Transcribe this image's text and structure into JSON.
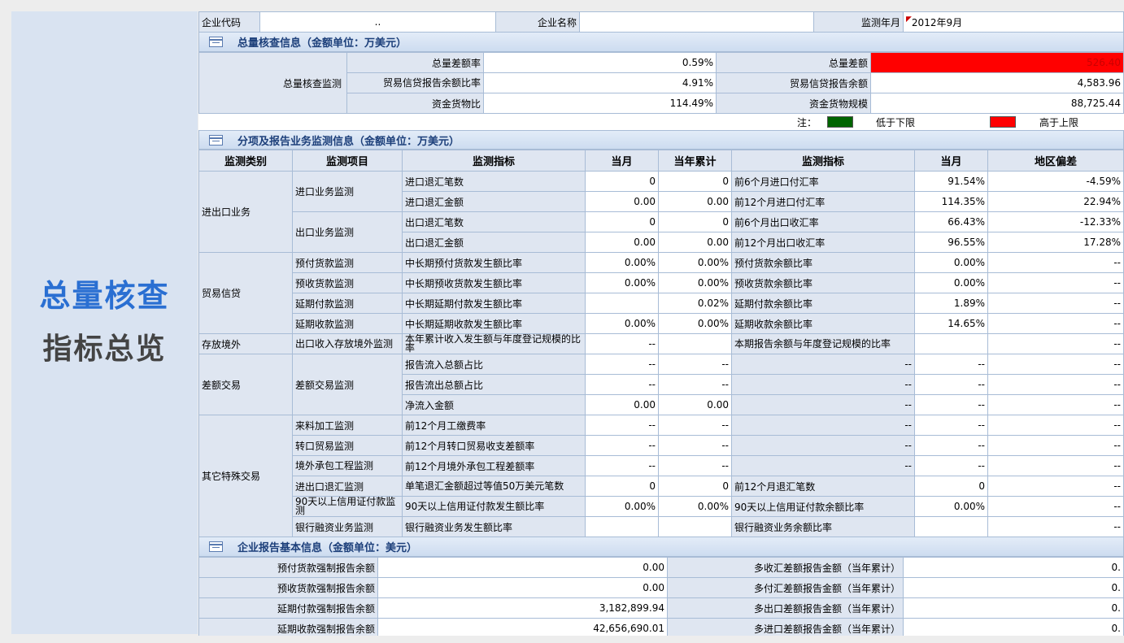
{
  "left_panel": {
    "line1": "总量核查",
    "line2": "指标总览"
  },
  "top": {
    "code_label": "企业代码",
    "code_value": "..",
    "name_label": "企业名称",
    "name_value": "",
    "month_label": "监测年月",
    "month_value": "2012年9月"
  },
  "section1": {
    "title": "总量核查信息（金额单位：万美元）",
    "group_label": "总量核查监测",
    "rows": [
      {
        "l1": "总量差额率",
        "v1": "0.59%",
        "l2": "总量差额",
        "v2": "526.40"
      },
      {
        "l1": "贸易信贷报告余额比率",
        "v1": "4.91%",
        "l2": "贸易信贷报告余额",
        "v2": "4,583.96"
      },
      {
        "l1": "资金货物比",
        "v1": "114.49%",
        "l2": "资金货物规模",
        "v2": "88,725.44"
      }
    ],
    "note_label": "注：",
    "legend_low": "低于下限",
    "legend_high": "高于上限",
    "colors": {
      "low": "#006400",
      "high": "#ff0000"
    }
  },
  "section2": {
    "title": "分项及报告业务监测信息（金额单位：万美元）",
    "headers": [
      "监测类别",
      "监测项目",
      "监测指标",
      "当月",
      "当年累计",
      "监测指标",
      "当月",
      "地区偏差"
    ],
    "cat_jck": "进出口业务",
    "item_jk": "进口业务监测",
    "item_ck": "出口业务监测",
    "cat_myxd": "贸易信贷",
    "cat_cfjw": "存放境外",
    "cat_ejy": "差额交易",
    "item_ejy": "差额交易监测",
    "cat_qt": "其它特殊交易",
    "r1": {
      "ind": "进口退汇笔数",
      "m": "0",
      "y": "0",
      "ind2": "前6个月进口付汇率",
      "m2": "91.54%",
      "d": "-4.59%"
    },
    "r2": {
      "ind": "进口退汇金额",
      "m": "0.00",
      "y": "0.00",
      "ind2": "前12个月进口付汇率",
      "m2": "114.35%",
      "d": "22.94%"
    },
    "r3": {
      "ind": "出口退汇笔数",
      "m": "0",
      "y": "0",
      "ind2": "前6个月出口收汇率",
      "m2": "66.43%",
      "d": "-12.33%"
    },
    "r4": {
      "ind": "出口退汇金额",
      "m": "0.00",
      "y": "0.00",
      "ind2": "前12个月出口收汇率",
      "m2": "96.55%",
      "d": "17.28%"
    },
    "r5": {
      "item": "预付货款监测",
      "ind": "中长期预付货款发生额比率",
      "m": "0.00%",
      "y": "0.00%",
      "ind2": "预付货款余额比率",
      "m2": "0.00%",
      "d": "--"
    },
    "r6": {
      "item": "预收货款监测",
      "ind": "中长期预收货款发生额比率",
      "m": "0.00%",
      "y": "0.00%",
      "ind2": "预收货款余额比率",
      "m2": "0.00%",
      "d": "--"
    },
    "r7": {
      "item": "延期付款监测",
      "ind": "中长期延期付款发生额比率",
      "m": "",
      "y": "0.02%",
      "ind2": "延期付款余额比率",
      "m2": "1.89%",
      "d": "--"
    },
    "r8": {
      "item": "延期收款监测",
      "ind": "中长期延期收款发生额比率",
      "m": "0.00%",
      "y": "0.00%",
      "ind2": "延期收款余额比率",
      "m2": "14.65%",
      "d": "--"
    },
    "r9": {
      "item": "出口收入存放境外监测",
      "ind": "本年累计收入发生额与年度登记规模的比率",
      "m": "--",
      "y": "",
      "ind2": "本期报告余额与年度登记规模的比率",
      "m2": "",
      "d": "--"
    },
    "r10": {
      "ind": "报告流入总额占比",
      "m": "--",
      "y": "--",
      "ind2": "--",
      "m2": "--",
      "d": "--"
    },
    "r11": {
      "ind": "报告流出总额占比",
      "m": "--",
      "y": "--",
      "ind2": "--",
      "m2": "--",
      "d": "--"
    },
    "r12": {
      "ind": "净流入金额",
      "m": "0.00",
      "y": "0.00",
      "ind2": "--",
      "m2": "--",
      "d": "--"
    },
    "r13": {
      "item": "来料加工监测",
      "ind": "前12个月工缴费率",
      "m": "--",
      "y": "--",
      "ind2": "--",
      "m2": "--",
      "d": "--"
    },
    "r14": {
      "item": "转口贸易监测",
      "ind": "前12个月转口贸易收支差额率",
      "m": "--",
      "y": "--",
      "ind2": "--",
      "m2": "--",
      "d": "--"
    },
    "r15": {
      "item": "境外承包工程监测",
      "ind": "前12个月境外承包工程差额率",
      "m": "--",
      "y": "--",
      "ind2": "--",
      "m2": "--",
      "d": "--"
    },
    "r16": {
      "item": "进出口退汇监测",
      "ind": "单笔退汇金额超过等值50万美元笔数",
      "m": "0",
      "y": "0",
      "ind2": "前12个月退汇笔数",
      "m2": "0",
      "d": "--"
    },
    "r17": {
      "item": "90天以上信用证付款监测",
      "ind": "90天以上信用证付款发生额比率",
      "m": "0.00%",
      "y": "0.00%",
      "ind2": "90天以上信用证付款余额比率",
      "m2": "0.00%",
      "d": "--"
    },
    "r18": {
      "item": "银行融资业务监测",
      "ind": "银行融资业务发生额比率",
      "m": "",
      "y": "",
      "ind2": "银行融资业务余额比率",
      "m2": "",
      "d": "--"
    }
  },
  "section3": {
    "title": "企业报告基本信息（金额单位：美元）",
    "rows": [
      {
        "l1": "预付货款强制报告余额",
        "v1": "0.00",
        "l2": "多收汇差额报告金额（当年累计）",
        "v2": "0."
      },
      {
        "l1": "预收货款强制报告余额",
        "v1": "0.00",
        "l2": "多付汇差额报告金额（当年累计）",
        "v2": "0."
      },
      {
        "l1": "延期付款强制报告余额",
        "v1": "3,182,899.94",
        "l2": "多出口差额报告金额（当年累计）",
        "v2": "0."
      },
      {
        "l1": "延期收款强制报告余额",
        "v1": "42,656,690.01",
        "l2": "多进口差额报告金额（当年累计）",
        "v2": "0."
      }
    ]
  }
}
